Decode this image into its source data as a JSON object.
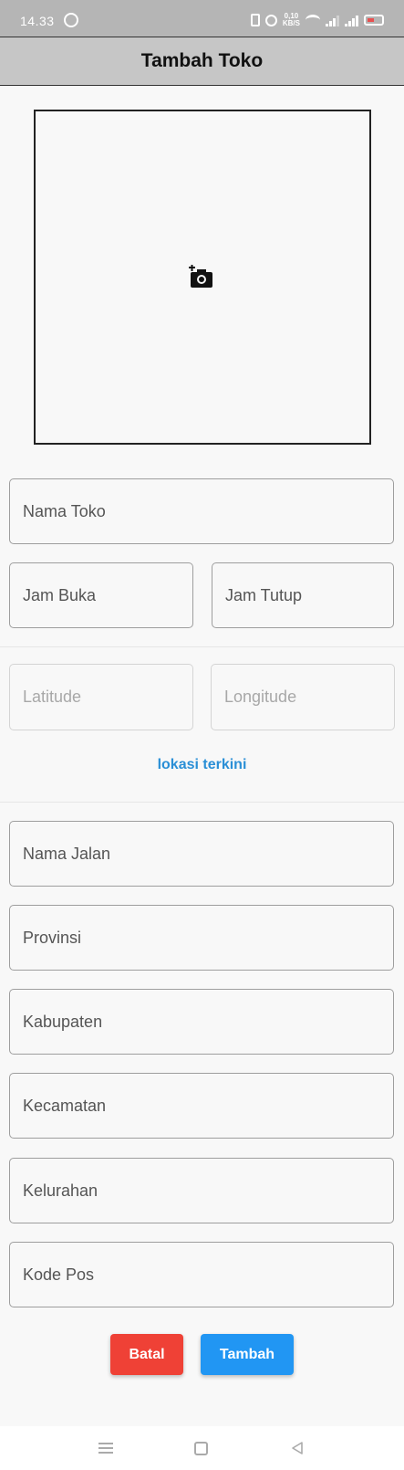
{
  "status_bar": {
    "time": "14.33",
    "speed_top": "0,10",
    "speed_bottom": "KB/S"
  },
  "app_bar": {
    "title": "Tambah Toko"
  },
  "photo": {
    "icon": "add-photo-icon"
  },
  "form": {
    "nama_toko": "Nama Toko",
    "jam_buka": "Jam Buka",
    "jam_tutup": "Jam Tutup",
    "latitude": "Latitude",
    "longitude": "Longitude",
    "lokasi_terkini": "lokasi terkini",
    "nama_jalan": "Nama Jalan",
    "provinsi": "Provinsi",
    "kabupaten": "Kabupaten",
    "kecamatan": "Kecamatan",
    "kelurahan": "Kelurahan",
    "kode_pos": "Kode Pos"
  },
  "buttons": {
    "cancel": "Batal",
    "add": "Tambah"
  },
  "colors": {
    "cancel": "#ef4136",
    "add": "#2196f3",
    "link": "#2a8fd6",
    "app_bar": "#c6c6c6"
  }
}
